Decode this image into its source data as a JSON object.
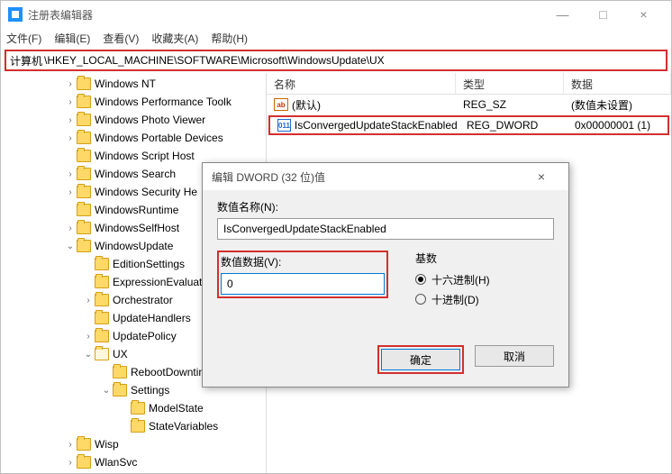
{
  "window": {
    "title": "注册表编辑器",
    "controls": {
      "min": "—",
      "max": "□",
      "close": "×"
    }
  },
  "menubar": [
    "文件(F)",
    "编辑(E)",
    "查看(V)",
    "收藏夹(A)",
    "帮助(H)"
  ],
  "addressbar": {
    "label": "计算机",
    "path": "\\HKEY_LOCAL_MACHINE\\SOFTWARE\\Microsoft\\WindowsUpdate\\UX"
  },
  "tree": [
    {
      "indent": 70,
      "chev": ">",
      "label": "Windows NT"
    },
    {
      "indent": 70,
      "chev": ">",
      "label": "Windows Performance Toolk"
    },
    {
      "indent": 70,
      "chev": ">",
      "label": "Windows Photo Viewer"
    },
    {
      "indent": 70,
      "chev": ">",
      "label": "Windows Portable Devices"
    },
    {
      "indent": 70,
      "chev": "",
      "label": "Windows Script Host"
    },
    {
      "indent": 70,
      "chev": ">",
      "label": "Windows Search"
    },
    {
      "indent": 70,
      "chev": ">",
      "label": "Windows Security He"
    },
    {
      "indent": 70,
      "chev": "",
      "label": "WindowsRuntime"
    },
    {
      "indent": 70,
      "chev": ">",
      "label": "WindowsSelfHost"
    },
    {
      "indent": 70,
      "chev": "v",
      "label": "WindowsUpdate"
    },
    {
      "indent": 90,
      "chev": "",
      "label": "EditionSettings"
    },
    {
      "indent": 90,
      "chev": "",
      "label": "ExpressionEvaluato"
    },
    {
      "indent": 90,
      "chev": ">",
      "label": "Orchestrator"
    },
    {
      "indent": 90,
      "chev": "",
      "label": "UpdateHandlers"
    },
    {
      "indent": 90,
      "chev": ">",
      "label": "UpdatePolicy"
    },
    {
      "indent": 90,
      "chev": "v",
      "label": "UX",
      "open": true
    },
    {
      "indent": 110,
      "chev": "",
      "label": "RebootDowntin"
    },
    {
      "indent": 110,
      "chev": "v",
      "label": "Settings"
    },
    {
      "indent": 130,
      "chev": "",
      "label": "ModelState"
    },
    {
      "indent": 130,
      "chev": "",
      "label": "StateVariables"
    },
    {
      "indent": 70,
      "chev": ">",
      "label": "Wisp"
    },
    {
      "indent": 70,
      "chev": ">",
      "label": "WlanSvc"
    }
  ],
  "list": {
    "headers": {
      "name": "名称",
      "type": "类型",
      "data": "数据"
    },
    "rows": [
      {
        "icon": "ab",
        "name": "(默认)",
        "type": "REG_SZ",
        "data": "(数值未设置)",
        "hl": false
      },
      {
        "icon": "bin",
        "name": "IsConvergedUpdateStackEnabled",
        "type": "REG_DWORD",
        "data": "0x00000001 (1)",
        "hl": true
      }
    ]
  },
  "dialog": {
    "title": "编辑 DWORD (32 位)值",
    "close": "×",
    "name_label": "数值名称(N):",
    "name_value": "IsConvergedUpdateStackEnabled",
    "data_label": "数值数据(V):",
    "data_value": "0",
    "base_label": "基数",
    "radio_hex": "十六进制(H)",
    "radio_dec": "十进制(D)",
    "ok": "确定",
    "cancel": "取消"
  }
}
